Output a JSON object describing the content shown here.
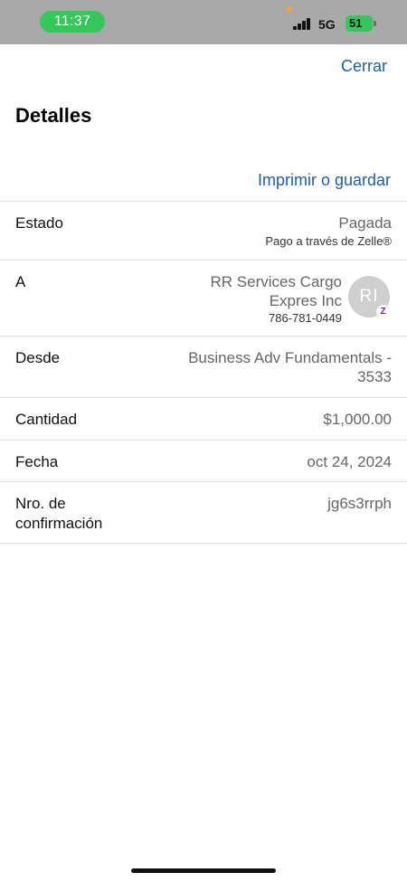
{
  "status_bar": {
    "time": "11:37",
    "network": "5G",
    "battery": "51"
  },
  "header": {
    "close_label": "Cerrar",
    "title": "Detalles",
    "print_label": "Imprimir o guardar"
  },
  "details": {
    "status": {
      "label": "Estado",
      "value": "Pagada",
      "sub": "Pago a través de Zelle®"
    },
    "recipient": {
      "label": "A",
      "name_line1": "RR Services Cargo",
      "name_line2": "Expres Inc",
      "phone": "786-781-0449",
      "initials": "RI",
      "badge": "Z"
    },
    "from": {
      "label": "Desde",
      "value_line1": "Business Adv Fundamentals -",
      "value_line2": "3533"
    },
    "amount": {
      "label": "Cantidad",
      "value": "$1,000.00"
    },
    "date": {
      "label": "Fecha",
      "value": "oct 24, 2024"
    },
    "confirmation": {
      "label_line1": "Nro. de",
      "label_line2": "confirmación",
      "value": "jg6s3rrph"
    }
  },
  "colors": {
    "link": "#1f5fa8",
    "status_green": "#34c759",
    "zelle_purple": "#6d1ed4"
  }
}
